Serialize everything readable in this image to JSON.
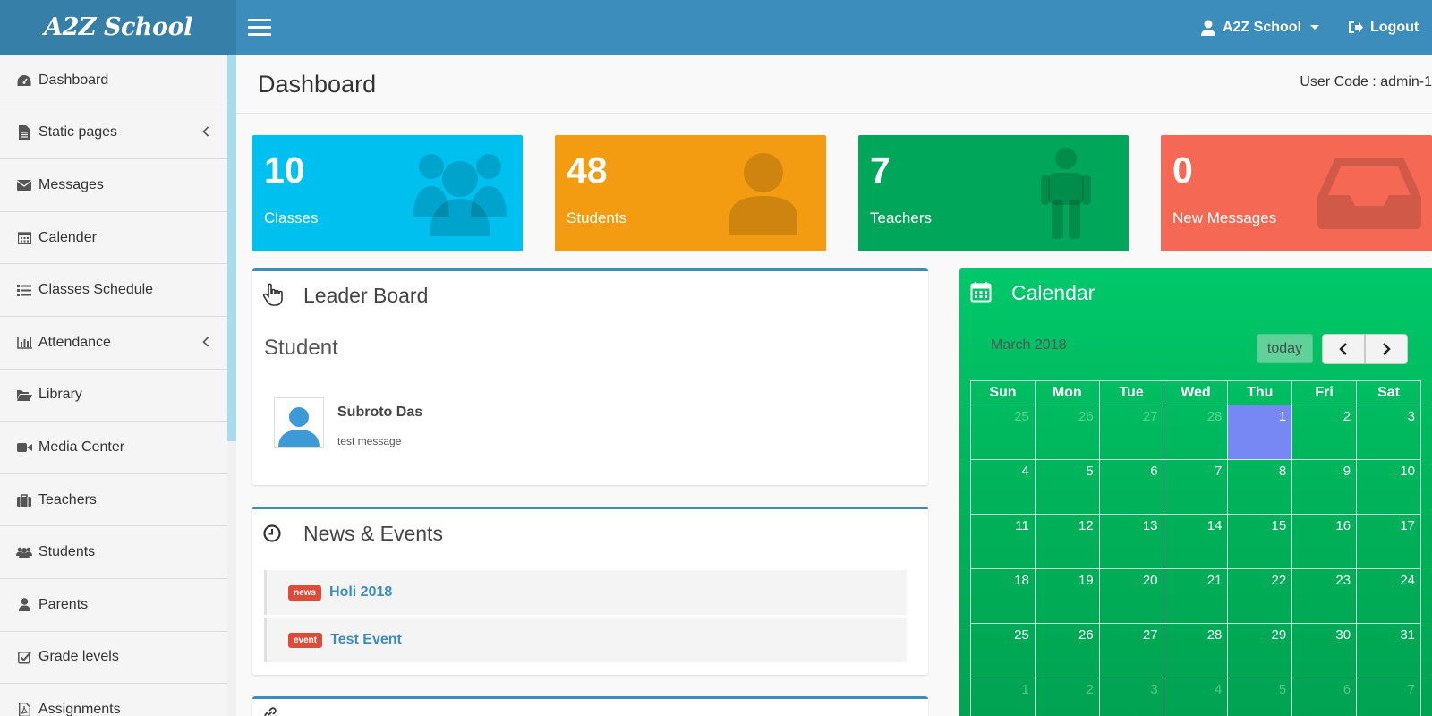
{
  "app": {
    "brand": "A2Z School",
    "user_name": "A2Z School",
    "logout_label": "Logout",
    "accent_color": "#3c8dbc"
  },
  "sidebar": {
    "items": [
      {
        "label": "Dashboard",
        "icon": "dashboard-icon",
        "has_submenu": false
      },
      {
        "label": "Static pages",
        "icon": "file-icon",
        "has_submenu": true
      },
      {
        "label": "Messages",
        "icon": "envelope-icon",
        "has_submenu": false
      },
      {
        "label": "Calender",
        "icon": "calendar-icon",
        "has_submenu": false
      },
      {
        "label": "Classes Schedule",
        "icon": "list-icon",
        "has_submenu": false
      },
      {
        "label": "Attendance",
        "icon": "bar-chart-icon",
        "has_submenu": true
      },
      {
        "label": "Library",
        "icon": "folder-open-icon",
        "has_submenu": false
      },
      {
        "label": "Media Center",
        "icon": "video-camera-icon",
        "has_submenu": false
      },
      {
        "label": "Teachers",
        "icon": "briefcase-icon",
        "has_submenu": false
      },
      {
        "label": "Students",
        "icon": "users-icon",
        "has_submenu": false
      },
      {
        "label": "Parents",
        "icon": "user-icon",
        "has_submenu": false
      },
      {
        "label": "Grade levels",
        "icon": "check-square-icon",
        "has_submenu": false
      },
      {
        "label": "Assignments",
        "icon": "file-pdf-icon",
        "has_submenu": false
      }
    ]
  },
  "header": {
    "page_title": "Dashboard",
    "user_code": "User Code : admin-1"
  },
  "stats": [
    {
      "value": "10",
      "label": "Classes",
      "color": "#00c0ef",
      "icon": "users-icon"
    },
    {
      "value": "48",
      "label": "Students",
      "color": "#f39c12",
      "icon": "user-icon"
    },
    {
      "value": "7",
      "label": "Teachers",
      "color": "#00a65a",
      "icon": "male-icon"
    },
    {
      "value": "0",
      "label": "New Messages",
      "color": "#f56954",
      "icon": "inbox-icon"
    }
  ],
  "leaderboard": {
    "title": "Leader Board",
    "category": "Student",
    "entries": [
      {
        "name": "Subroto Das",
        "message": "test message"
      }
    ]
  },
  "news": {
    "title": "News & Events",
    "items": [
      {
        "tag": "news",
        "title": "Holi 2018"
      },
      {
        "tag": "event",
        "title": "Test Event"
      }
    ]
  },
  "calendar": {
    "title": "Calendar",
    "month_label": "March 2018",
    "today_label": "today",
    "weekdays": [
      "Sun",
      "Mon",
      "Tue",
      "Wed",
      "Thu",
      "Fri",
      "Sat"
    ],
    "weeks": [
      [
        {
          "d": "25",
          "o": true
        },
        {
          "d": "26",
          "o": true
        },
        {
          "d": "27",
          "o": true
        },
        {
          "d": "28",
          "o": true
        },
        {
          "d": "1",
          "t": true
        },
        {
          "d": "2"
        },
        {
          "d": "3"
        }
      ],
      [
        {
          "d": "4"
        },
        {
          "d": "5"
        },
        {
          "d": "6"
        },
        {
          "d": "7"
        },
        {
          "d": "8"
        },
        {
          "d": "9"
        },
        {
          "d": "10"
        }
      ],
      [
        {
          "d": "11"
        },
        {
          "d": "12"
        },
        {
          "d": "13"
        },
        {
          "d": "14"
        },
        {
          "d": "15"
        },
        {
          "d": "16"
        },
        {
          "d": "17"
        }
      ],
      [
        {
          "d": "18"
        },
        {
          "d": "19"
        },
        {
          "d": "20"
        },
        {
          "d": "21"
        },
        {
          "d": "22"
        },
        {
          "d": "23"
        },
        {
          "d": "24"
        }
      ],
      [
        {
          "d": "25"
        },
        {
          "d": "26"
        },
        {
          "d": "27"
        },
        {
          "d": "28"
        },
        {
          "d": "29"
        },
        {
          "d": "30"
        },
        {
          "d": "31"
        }
      ],
      [
        {
          "d": "1",
          "o": true
        },
        {
          "d": "2",
          "o": true
        },
        {
          "d": "3",
          "o": true
        },
        {
          "d": "4",
          "o": true
        },
        {
          "d": "5",
          "o": true
        },
        {
          "d": "6",
          "o": true
        },
        {
          "d": "7",
          "o": true
        }
      ]
    ],
    "today_color": "#7788f4"
  }
}
